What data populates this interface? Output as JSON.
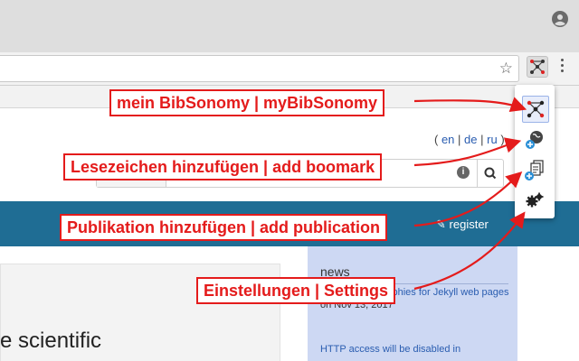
{
  "browser": {
    "address_bar_value": "",
    "icons": [
      "profile-icon",
      "star-icon",
      "bibsonomy-extension-icon",
      "menu-icon"
    ]
  },
  "page": {
    "languages": [
      "en",
      "de",
      "ru"
    ],
    "register_label": "register",
    "headline_fragment": "e scientific",
    "news": {
      "title": "news",
      "items": [
        {
          "title": "BibTeX bibliographies for Jekyll web pages",
          "date": "on Nov 13, 2017"
        },
        {
          "title": "HTTP access will be disabled in",
          "date": ""
        }
      ]
    }
  },
  "popup": {
    "items": [
      {
        "name": "my-bibsonomy",
        "icon": "network-icon"
      },
      {
        "name": "add-bookmark",
        "icon": "globe-plus-icon"
      },
      {
        "name": "add-publication",
        "icon": "document-plus-icon"
      },
      {
        "name": "settings",
        "icon": "gears-icon"
      }
    ]
  },
  "callouts": {
    "my_bibsonomy": "mein BibSonomy | myBibSonomy",
    "add_bookmark": "Lesezeichen hinzufügen | add boomark",
    "add_publication": "Publikation hinzufügen | add publication",
    "settings": "Einstellungen | Settings"
  },
  "colors": {
    "annotation": "#e41b1b",
    "navbar": "#1f6d94",
    "news_panel": "#cdd8f3",
    "link": "#2a5db0"
  }
}
